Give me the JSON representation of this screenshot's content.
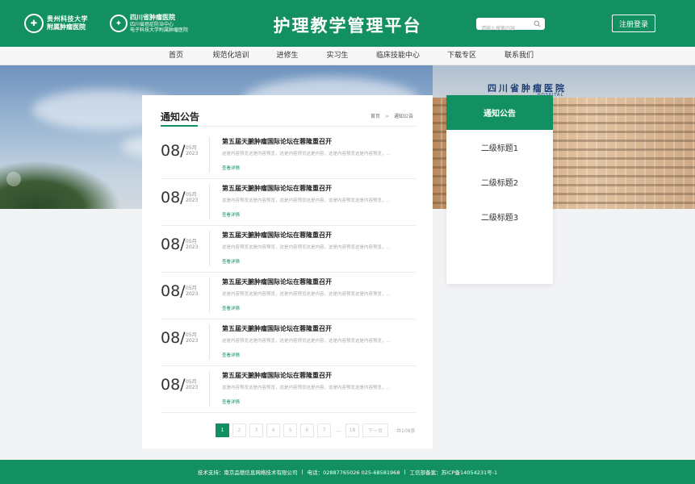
{
  "header": {
    "logo1_line1": "贵州科技大学",
    "logo1_line2": "附属肿瘤医院",
    "logo2_line1": "四川省肿瘤医院",
    "logo2_line2": "四川省癌症防治中心",
    "logo2_line3": "电子科技大学附属肿瘤医院",
    "title": "护理教学管理平台",
    "search_placeholder": "请输入搜索内容",
    "register_label": "注册登录"
  },
  "nav": {
    "items": [
      "首页",
      "规范化培训",
      "进修生",
      "实习生",
      "临床技能中心",
      "下载专区",
      "联系我们"
    ]
  },
  "banner": {
    "building_sign": "四川省肿瘤医院",
    "building_sign_sub": "HOSPITAL"
  },
  "content": {
    "section_title": "通知公告",
    "breadcrumb": [
      "首页",
      "通知公告"
    ],
    "breadcrumb_sep": ">",
    "news": [
      {
        "day": "08/",
        "month": "05月",
        "year": "2023",
        "title": "第五届天腑肿瘤国际论坛在蓉隆重召开",
        "summary": "这是内容预览这是内容预览，这是内容预览这是内容，这是内容预览这是内容预览，...",
        "more": "查看详情"
      },
      {
        "day": "08/",
        "month": "05月",
        "year": "2023",
        "title": "第五届天腑肿瘤国际论坛在蓉隆重召开",
        "summary": "这是内容预览这是内容预览，这是内容预览这是内容，这是内容预览这是内容预览，...",
        "more": "查看详情"
      },
      {
        "day": "08/",
        "month": "05月",
        "year": "2023",
        "title": "第五届天腑肿瘤国际论坛在蓉隆重召开",
        "summary": "这是内容预览这是内容预览，这是内容预览这是内容，这是内容预览这是内容预览，...",
        "more": "查看详情"
      },
      {
        "day": "08/",
        "month": "05月",
        "year": "2023",
        "title": "第五届天腑肿瘤国际论坛在蓉隆重召开",
        "summary": "这是内容预览这是内容预览，这是内容预览这是内容，这是内容预览这是内容预览，...",
        "more": "查看详情"
      },
      {
        "day": "08/",
        "month": "05月",
        "year": "2023",
        "title": "第五届天腑肿瘤国际论坛在蓉隆重召开",
        "summary": "这是内容预览这是内容预览，这是内容预览这是内容，这是内容预览这是内容预览，...",
        "more": "查看详情"
      },
      {
        "day": "08/",
        "month": "05月",
        "year": "2023",
        "title": "第五届天腑肿瘤国际论坛在蓉隆重召开",
        "summary": "这是内容预览这是内容预览，这是内容预览这是内容，这是内容预览这是内容预览，...",
        "more": "查看详情"
      }
    ]
  },
  "pagination": {
    "pages": [
      "1",
      "2",
      "3",
      "4",
      "5",
      "6",
      "7"
    ],
    "ellipsis": "...",
    "last": "18",
    "next": "下一页",
    "total": "共108条",
    "current": "1"
  },
  "sidebar": {
    "heading": "通知公告",
    "items": [
      "二级标题1",
      "二级标题2",
      "二级标题3"
    ]
  },
  "footer": {
    "support": "技术支持：南京品德信息网络技术有限公司",
    "phone": "电话：02887765026  025-68581968",
    "icp": "工信部备案：苏ICP备14054231号-1",
    "sep": "|"
  },
  "colors": {
    "brand_green": "#139061"
  }
}
